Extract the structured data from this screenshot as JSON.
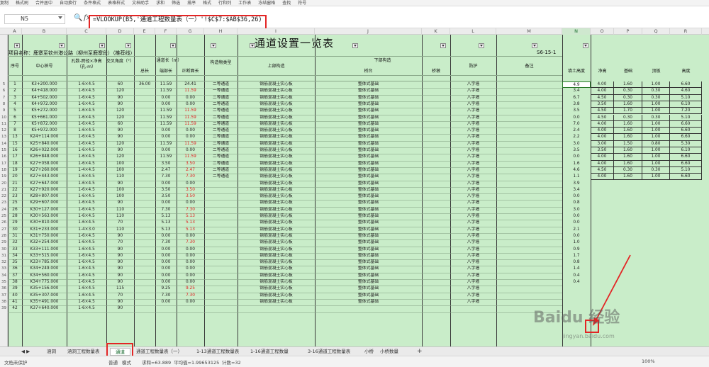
{
  "toolbar": {
    "items": [
      "复制",
      "格式刷",
      "合并居中",
      "自动换行",
      "条件格式",
      "表格样式",
      "文档助手",
      "求和",
      "筛选",
      "排序",
      "格式",
      "行和列",
      "工作表",
      "冻结窗格",
      "查找",
      "符号"
    ]
  },
  "namebox": {
    "value": "N5"
  },
  "formula": {
    "zoom_icon": "🔍",
    "fx": "fx",
    "text": "=VLOOKUP(B5,'通道工程数量表（一）'!$C$7:$AB$36,26)"
  },
  "columns": [
    "A",
    "B",
    "C",
    "D",
    "E",
    "F",
    "G",
    "H",
    "I",
    "J",
    "K",
    "L",
    "M",
    "N",
    "O",
    "P",
    "Q",
    "R"
  ],
  "sheet": {
    "title": "通道设置一览表",
    "project": "项目名称：鹿寨至钦州港公路（柳州至鹿寨段）（推荐线）",
    "docno": "S6-15-1",
    "hdr": {
      "seq": "序号",
      "stake": "中心桩号",
      "span": "孔数-跨径×净高（孔-m）",
      "angle": "交叉角度（°）",
      "len": "通道长（m）",
      "total": "总长",
      "end": "端部长",
      "mid": "正断面长",
      "struct": "构造物类型",
      "super": "上部构造",
      "sub": "下部构造",
      "abut": "桥台",
      "pier": "桥墩",
      "protect": "防护",
      "note": "备注",
      "fill": "填土高度",
      "netH": "净高",
      "base": "基础",
      "top": "顶板",
      "height": "高度"
    },
    "rows": [
      [
        "5",
        "1",
        "K3+200.000",
        "1-6×4.5",
        "60",
        "36.00",
        "11.59",
        "24.41",
        "二等通道",
        "钢筋混凝土实心板",
        "整体式基础",
        "八字墙",
        "4.9"
      ],
      [
        "6",
        "2",
        "K4+418.000",
        "1-6×4.5",
        "120",
        "",
        "11.59",
        "11.59",
        "一等通道",
        "钢筋混凝土实心板",
        "整体式基础",
        "八字墙",
        "3.4"
      ],
      [
        "7",
        "3",
        "K4+502.000",
        "1-6×4.5",
        "90",
        "",
        "0.00",
        "0.00",
        "二等通道",
        "钢筋混凝土实心板",
        "整体式基础",
        "八字墙",
        "6.7"
      ],
      [
        "8",
        "4",
        "K4+972.000",
        "1-6×4.5",
        "90",
        "",
        "0.00",
        "0.00",
        "二等通道",
        "钢筋混凝土实心板",
        "整体式基础",
        "八字墙",
        "3.8"
      ],
      [
        "9",
        "5",
        "K5+272.000",
        "1-6×4.5",
        "120",
        "",
        "11.59",
        "11.59",
        "二等通道",
        "钢筋混凝土实心板",
        "整体式基础",
        "八字墙",
        "3.5"
      ],
      [
        "10",
        "6",
        "K5+661.000",
        "1-6×4.5",
        "120",
        "",
        "11.59",
        "11.59",
        "二等通道",
        "钢筋混凝土实心板",
        "整体式基础",
        "八字墙",
        "0.0"
      ],
      [
        "11",
        "7",
        "K5+872.000",
        "1-6×4.5",
        "60",
        "",
        "11.59",
        "11.59",
        "二等通道",
        "钢筋混凝土实心板",
        "整体式基础",
        "八字墙",
        "7.0"
      ],
      [
        "12",
        "8",
        "K5+972.000",
        "1-6×4.5",
        "90",
        "",
        "0.00",
        "0.00",
        "二等通道",
        "钢筋混凝土实心板",
        "整体式基础",
        "八字墙",
        "2.4"
      ],
      [
        "13",
        "13",
        "K24+114.000",
        "1-6×4.5",
        "90",
        "",
        "0.00",
        "0.00",
        "二等通道",
        "钢筋混凝土实心板",
        "整体式基础",
        "八字墙",
        "2.2"
      ],
      [
        "14",
        "15",
        "K25+840.000",
        "1-6×4.5",
        "120",
        "",
        "11.59",
        "11.59",
        "二等通道",
        "钢筋混凝土实心板",
        "整体式基础",
        "八字墙",
        "3.0"
      ],
      [
        "15",
        "16",
        "K26+022.000",
        "1-6×4.5",
        "90",
        "",
        "0.00",
        "0.00",
        "二等通道",
        "钢筋混凝土实心板",
        "整体式基础",
        "八字墙",
        "3.5"
      ],
      [
        "16",
        "17",
        "K26+848.000",
        "1-6×4.5",
        "120",
        "",
        "11.59",
        "11.59",
        "二等通道",
        "钢筋混凝土实心板",
        "整体式基础",
        "八字墙",
        "0.0"
      ],
      [
        "17",
        "18",
        "K27+058.000",
        "1-6×4.5",
        "100",
        "",
        "3.50",
        "3.50",
        "二等通道",
        "钢筋混凝土实心板",
        "整体式基础",
        "八字墙",
        "1.6"
      ],
      [
        "18",
        "19",
        "K27+260.000",
        "1-4×4.5",
        "100",
        "",
        "2.47",
        "2.47",
        "二等通道",
        "钢筋混凝土实心板",
        "整体式基础",
        "八字墙",
        "4.6"
      ],
      [
        "19",
        "20",
        "K27+443.000",
        "1-6×4.5",
        "110",
        "",
        "7.30",
        "7.30",
        "二等通道",
        "钢筋混凝土实心板",
        "整体式基础",
        "八字墙",
        "1.1"
      ],
      [
        "20",
        "21",
        "K27+647.000",
        "1-6×4.5",
        "90",
        "",
        "0.00",
        "0.00",
        "",
        "钢筋混凝土实心板",
        "整体式基础",
        "八字墙",
        "3.9"
      ],
      [
        "21",
        "22",
        "K27+920.000",
        "1-6×4.5",
        "100",
        "",
        "3.50",
        "3.50",
        "",
        "钢筋混凝土实心板",
        "整体式基础",
        "八字墙",
        "3.4"
      ],
      [
        "22",
        "23",
        "K28+807.000",
        "1-6×4.5",
        "100",
        "",
        "3.50",
        "3.50",
        "",
        "钢筋混凝土实心板",
        "整体式基础",
        "八字墙",
        "0.0"
      ],
      [
        "23",
        "25",
        "K29+607.000",
        "1-6×4.5",
        "90",
        "",
        "0.00",
        "0.00",
        "",
        "钢筋混凝土实心板",
        "整体式基础",
        "八字墙",
        "0.8"
      ],
      [
        "24",
        "26",
        "K30+127.000",
        "1-6×4.5",
        "110",
        "",
        "7.30",
        "7.30",
        "",
        "钢筋混凝土实心板",
        "整体式基础",
        "八字墙",
        "3.0"
      ],
      [
        "25",
        "28",
        "K30+563.000",
        "1-6×4.5",
        "110",
        "",
        "5.13",
        "5.13",
        "",
        "钢筋混凝土实心板",
        "整体式基础",
        "八字墙",
        "0.0"
      ],
      [
        "26",
        "29",
        "K30+810.000",
        "1-6×4.5",
        "70",
        "",
        "5.13",
        "5.13",
        "",
        "钢筋混凝土实心板",
        "整体式基础",
        "八字墙",
        "0.0"
      ],
      [
        "27",
        "30",
        "K31+233.000",
        "1-4×3.0",
        "110",
        "",
        "5.13",
        "5.13",
        "",
        "钢筋混凝土实心板",
        "整体式基础",
        "八字墙",
        "2.1"
      ],
      [
        "28",
        "31",
        "K31+750.000",
        "1-6×4.5",
        "90",
        "",
        "0.00",
        "0.00",
        "",
        "钢筋混凝土实心板",
        "整体式基础",
        "八字墙",
        "0.0"
      ],
      [
        "29",
        "32",
        "K32+254.000",
        "1-6×4.5",
        "70",
        "",
        "7.30",
        "7.30",
        "",
        "钢筋混凝土实心板",
        "整体式基础",
        "八字墙",
        "1.0"
      ],
      [
        "30",
        "33",
        "K33+111.000",
        "1-6×4.5",
        "90",
        "",
        "0.00",
        "0.00",
        "",
        "钢筋混凝土实心板",
        "整体式基础",
        "八字墙",
        "0.9"
      ],
      [
        "31",
        "34",
        "K33+515.000",
        "1-6×4.5",
        "90",
        "",
        "0.00",
        "0.00",
        "",
        "钢筋混凝土实心板",
        "整体式基础",
        "八字墙",
        "1.7"
      ],
      [
        "32",
        "35",
        "K33+785.000",
        "1-6×4.5",
        "90",
        "",
        "0.00",
        "0.00",
        "",
        "钢筋混凝土实心板",
        "整体式基础",
        "八字墙",
        "0.8"
      ],
      [
        "33",
        "36",
        "K34+249.000",
        "1-6×4.5",
        "90",
        "",
        "0.00",
        "0.00",
        "",
        "钢筋混凝土实心板",
        "整体式基础",
        "八字墙",
        "1.4"
      ],
      [
        "34",
        "37",
        "K34+560.000",
        "1-6×4.5",
        "90",
        "",
        "0.00",
        "0.00",
        "",
        "钢筋混凝土实心板",
        "整体式基础",
        "八字墙",
        "0.4"
      ],
      [
        "35",
        "38",
        "K34+775.000",
        "1-6×4.5",
        "90",
        "",
        "0.00",
        "0.00",
        "",
        "钢筋混凝土实心板",
        "整体式基础",
        "八字墙",
        "0.4"
      ],
      [
        "36",
        "39",
        "K35+156.000",
        "1-6×4.5",
        "115",
        "",
        "9.25",
        "9.25",
        "",
        "钢筋混凝土实心板",
        "整体式基础",
        "八字墙",
        ""
      ],
      [
        "37",
        "40",
        "K35+307.000",
        "1-6×4.5",
        "70",
        "",
        "7.30",
        "7.30",
        "",
        "钢筋混凝土实心板",
        "整体式基础",
        "八字墙",
        ""
      ],
      [
        "38",
        "41",
        "K35+491.000",
        "1-6×4.5",
        "90",
        "",
        "0.00",
        "0.00",
        "",
        "钢筋混凝土实心板",
        "整体式基础",
        "八字墙",
        ""
      ],
      [
        "39",
        "42",
        "K37+640.000",
        "1-6×4.5",
        "90",
        "",
        "",
        "",
        "",
        "",
        "",
        "",
        ""
      ]
    ],
    "lookup": [
      [
        "4.00",
        "1.60",
        "1.00",
        "6.60"
      ],
      [
        "4.00",
        "0.30",
        "0.30",
        "4.60"
      ],
      [
        "4.50",
        "0.30",
        "0.30",
        "5.10"
      ],
      [
        "3.50",
        "1.60",
        "1.00",
        "6.10"
      ],
      [
        "4.50",
        "1.70",
        "1.00",
        "7.20"
      ],
      [
        "4.50",
        "0.30",
        "0.30",
        "5.10"
      ],
      [
        "4.00",
        "1.60",
        "1.00",
        "6.60"
      ],
      [
        "4.00",
        "1.60",
        "1.00",
        "6.60"
      ],
      [
        "4.00",
        "1.60",
        "1.00",
        "6.60"
      ],
      [
        "3.00",
        "1.50",
        "0.80",
        "5.30"
      ],
      [
        "3.50",
        "1.60",
        "1.00",
        "6.10"
      ],
      [
        "4.00",
        "1.60",
        "1.00",
        "6.60"
      ],
      [
        "4.00",
        "1.60",
        "1.00",
        "6.60"
      ],
      [
        "4.50",
        "0.30",
        "0.30",
        "5.10"
      ],
      [
        "4.00",
        "1.60",
        "1.00",
        "6.60"
      ]
    ]
  },
  "tabs": {
    "nav": "◀ ▶",
    "items": [
      "涵洞",
      "涵洞工程数量表",
      "通道",
      "通道工程数量表（一）",
      "1-13通道工程数量表",
      "1-16通道工程数量",
      "3-16通道工程数量表",
      "小桥",
      "小桥数量"
    ],
    "add": "+"
  },
  "status": {
    "protect": "文档未保护",
    "sum": "求和=63.889",
    "avg": "平均值=1.99653125",
    "count": "计数=32",
    "zoom": "100%",
    "mode1": "普通",
    "mode2": "模式"
  },
  "watermark": {
    "main": "Baidu 经验",
    "sub": "jingyan.baidu.com"
  },
  "colors": {
    "sheet_bg": "#c9edc9",
    "highlight": "#e32525",
    "red_text": "#e02020"
  }
}
